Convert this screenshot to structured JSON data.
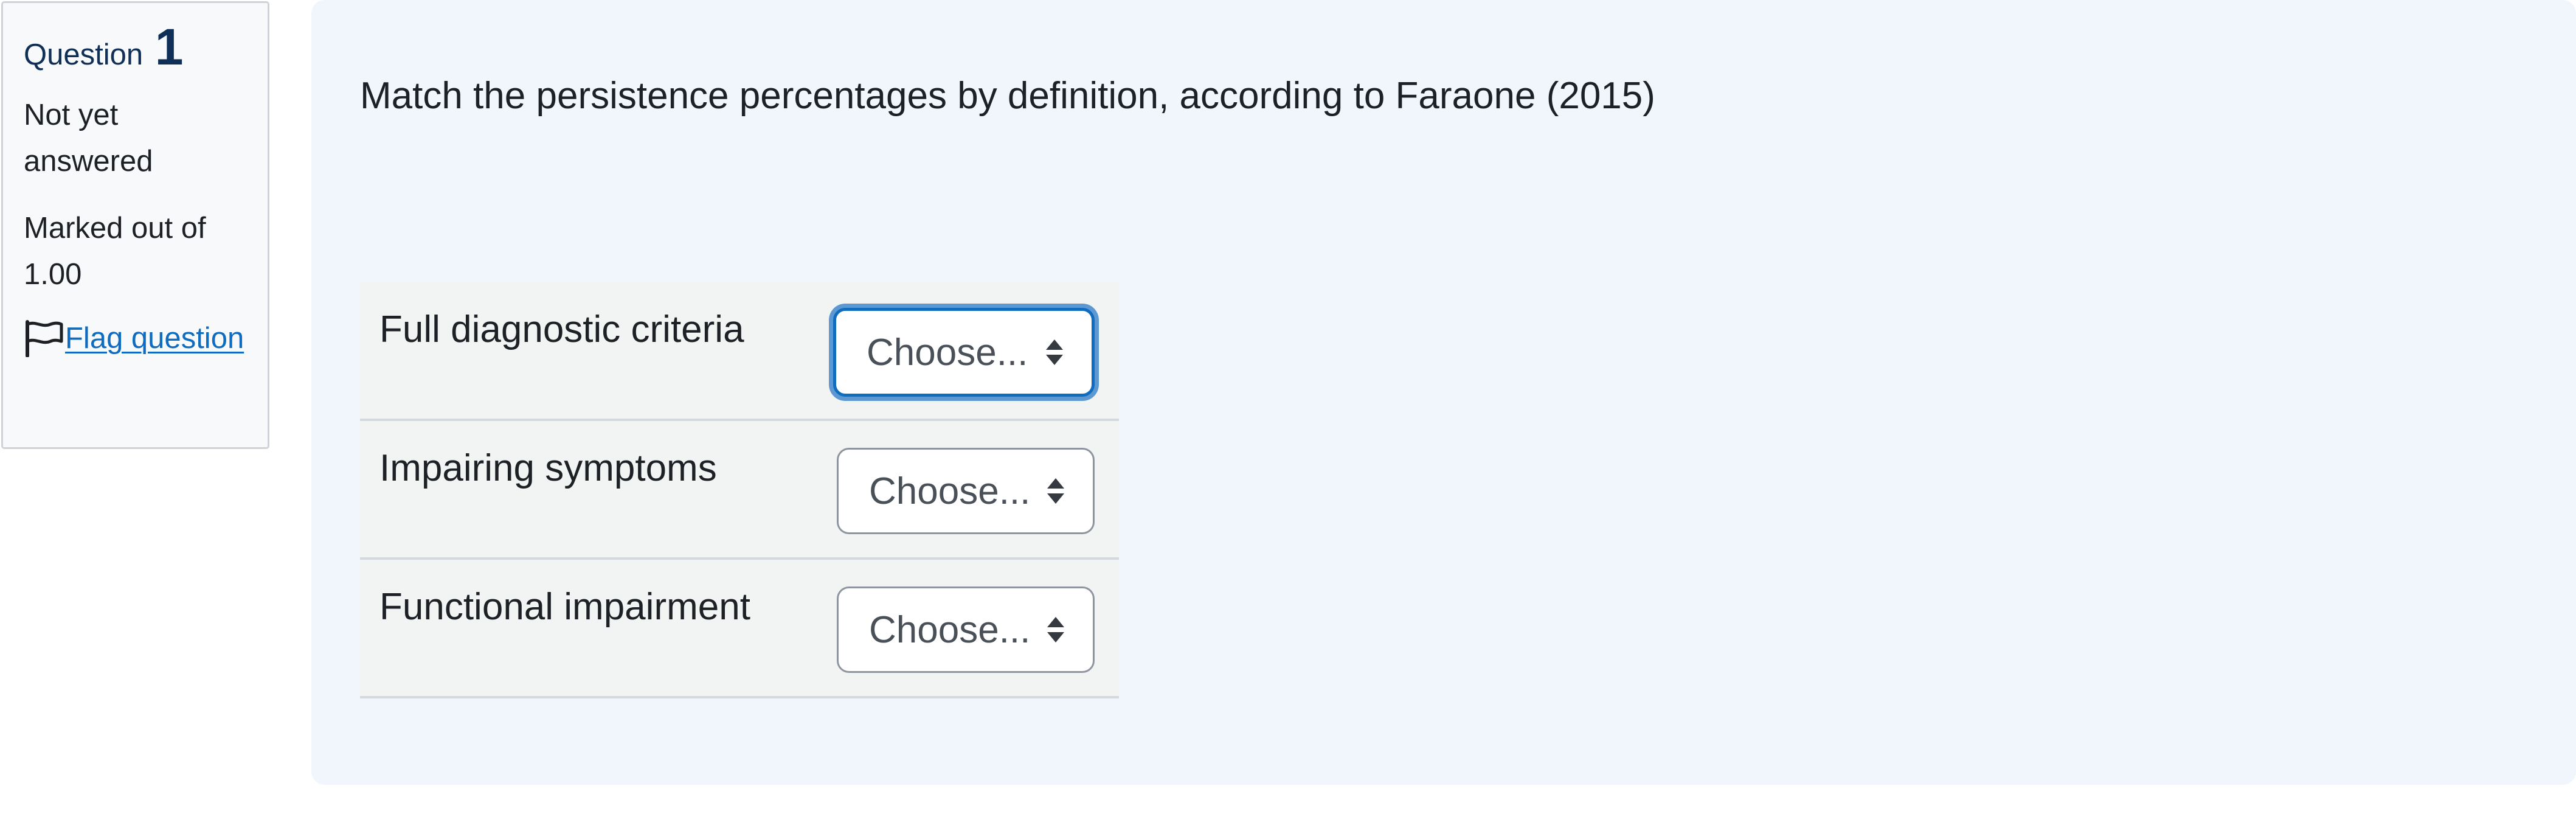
{
  "question_info": {
    "label": "Question",
    "number": "1",
    "state": "Not yet answered",
    "grade": "Marked out of 1.00",
    "flag_label": "Flag question"
  },
  "question": {
    "text": "Match the persistence percentages by definition, according to Faraone (2015)"
  },
  "answers": [
    {
      "label": "Full diagnostic criteria",
      "selected": "Choose..."
    },
    {
      "label": "Impairing symptoms",
      "selected": "Choose..."
    },
    {
      "label": "Functional impairment",
      "selected": "Choose..."
    }
  ],
  "colors": {
    "link": "#0f6cbf",
    "focus_ring": "#5d98d3",
    "content_bg": "#f1f6fd",
    "info_bg": "#f8f9fa"
  },
  "icons": {
    "flag": "flag-outline-icon",
    "select_arrows": "sort-arrows-icon"
  }
}
